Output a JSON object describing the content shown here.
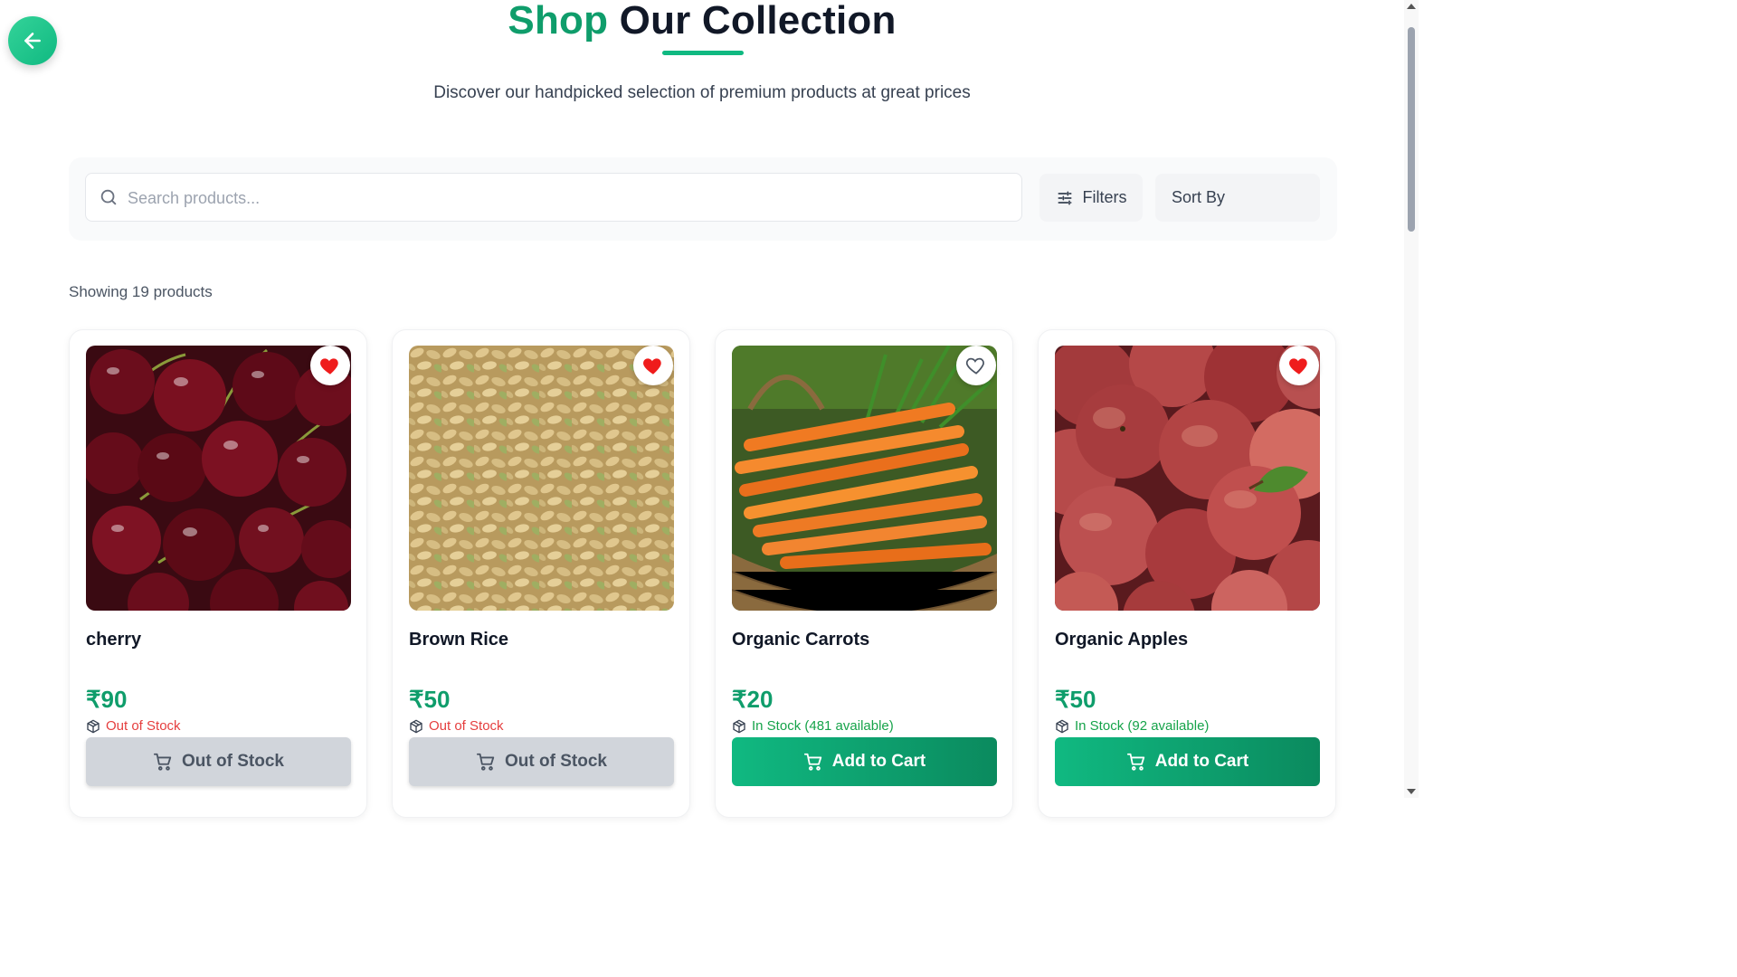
{
  "header": {
    "title_accent": "Shop",
    "title_rest": "Our Collection",
    "subtitle": "Discover our handpicked selection of premium products at great prices"
  },
  "back_button": {
    "icon": "arrow-left-icon"
  },
  "toolbar": {
    "search_placeholder": "Search products...",
    "filters_label": "Filters",
    "sort_label": "Sort By"
  },
  "results": {
    "count_text": "Showing 19 products"
  },
  "products": [
    {
      "name": "cherry",
      "price": "₹90",
      "stock_text": "Out of Stock",
      "in_stock": false,
      "favorited": true,
      "button_label": "Out of Stock"
    },
    {
      "name": "Brown Rice",
      "price": "₹50",
      "stock_text": "Out of Stock",
      "in_stock": false,
      "favorited": true,
      "button_label": "Out of Stock"
    },
    {
      "name": "Organic Carrots",
      "price": "₹20",
      "stock_text": "In Stock (481 available)",
      "in_stock": true,
      "favorited": false,
      "button_label": "Add to Cart"
    },
    {
      "name": "Organic Apples",
      "price": "₹50",
      "stock_text": "In Stock (92 available)",
      "in_stock": true,
      "favorited": true,
      "button_label": "Add to Cart"
    }
  ],
  "colors": {
    "accent": "#10b981",
    "price": "#0f9d6b",
    "out_of_stock": "#e53e3e",
    "in_stock": "#16a34a",
    "heart": "#ef1c1c"
  }
}
